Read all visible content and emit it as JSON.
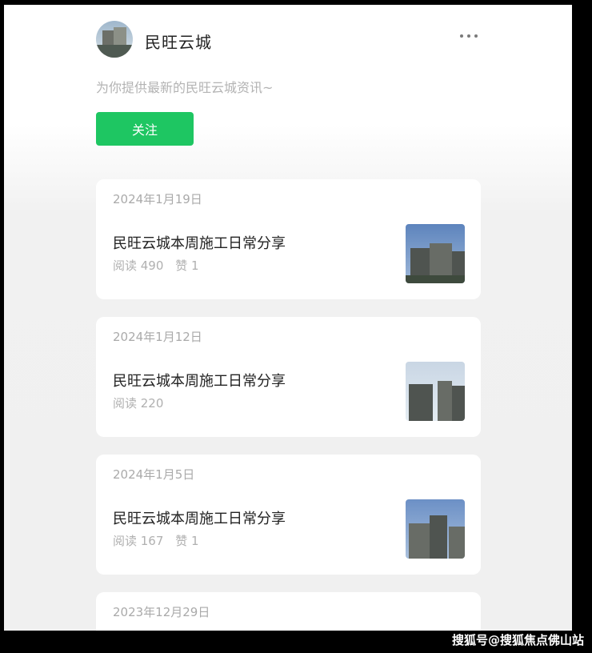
{
  "account": {
    "name": "民旺云城",
    "description": "为你提供最新的民旺云城资讯~",
    "follow_label": "关注"
  },
  "articles": [
    {
      "date": "2024年1月19日",
      "title": "民旺云城本周施工日常分享",
      "reads": "阅读 490",
      "likes": "赞 1"
    },
    {
      "date": "2024年1月12日",
      "title": "民旺云城本周施工日常分享",
      "reads": "阅读 220"
    },
    {
      "date": "2024年1月5日",
      "title": "民旺云城本周施工日常分享",
      "reads": "阅读 167",
      "likes": "赞 1"
    },
    {
      "date": "2023年12月29日"
    }
  ],
  "watermark": "搜狐号@搜狐焦点佛山站",
  "icons": {
    "more": "more-horizontal-icon",
    "avatar": "account-avatar-image"
  },
  "colors": {
    "accent_green": "#1ec662",
    "background": "#f0f0f0",
    "card": "#ffffff"
  }
}
